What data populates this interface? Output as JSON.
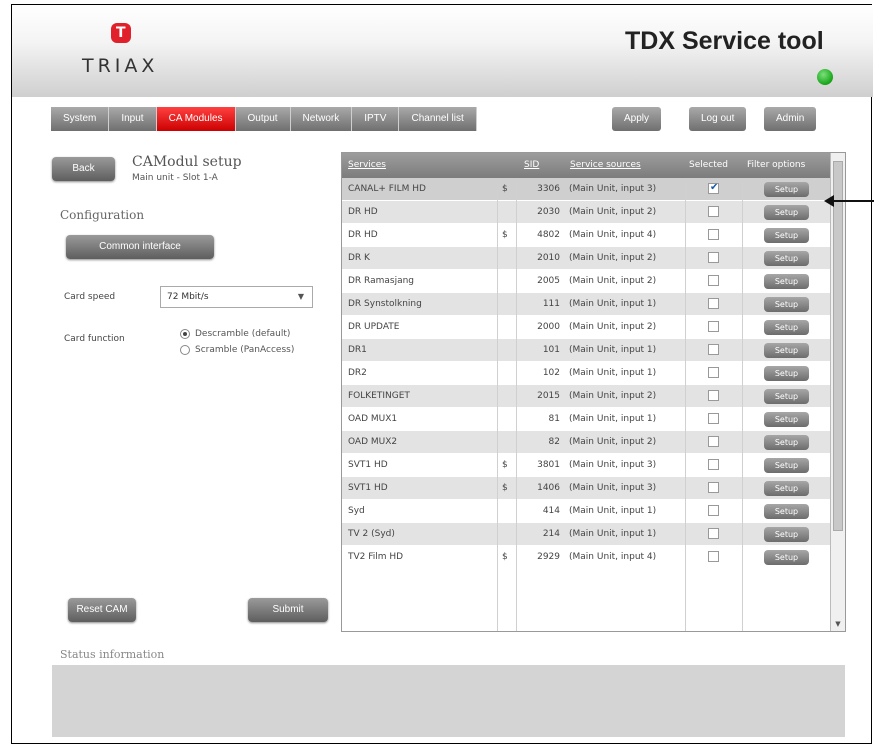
{
  "app": {
    "title": "TDX Service tool",
    "logo_letter": "T",
    "logo_text": "TRIAX"
  },
  "nav": {
    "tabs": [
      {
        "label": "System"
      },
      {
        "label": "Input"
      },
      {
        "label": "CA Modules",
        "active": true
      },
      {
        "label": "Output"
      },
      {
        "label": "Network"
      },
      {
        "label": "IPTV"
      },
      {
        "label": "Channel list"
      }
    ]
  },
  "header_buttons": {
    "apply": "Apply",
    "logout": "Log out",
    "admin": "Admin"
  },
  "page": {
    "back": "Back",
    "title": "CAModul setup",
    "subtitle": "Main unit - Slot 1-A"
  },
  "config": {
    "heading": "Configuration",
    "common_interface": "Common interface",
    "card_speed_label": "Card speed",
    "card_speed_value": "72 Mbit/s",
    "card_function_label": "Card function",
    "radio_descramble": "Descramble (default)",
    "radio_scramble": "Scramble (PanAccess)",
    "radio_selected": "descramble"
  },
  "table": {
    "headers": {
      "services": "Services",
      "sid": "SID",
      "sources": "Service sources",
      "selected": "Selected",
      "filter": "Filter options"
    },
    "setup_label": "Setup",
    "rows": [
      {
        "service": "CANAL+ FILM HD",
        "flag": "$",
        "sid": "3306",
        "source": "(Main Unit, input 3)",
        "selected": true
      },
      {
        "service": "DR HD",
        "flag": "",
        "sid": "2030",
        "source": "(Main Unit, input 2)",
        "selected": false
      },
      {
        "service": "DR HD",
        "flag": "$",
        "sid": "4802",
        "source": "(Main Unit, input 4)",
        "selected": false
      },
      {
        "service": "DR K",
        "flag": "",
        "sid": "2010",
        "source": "(Main Unit, input 2)",
        "selected": false
      },
      {
        "service": "DR Ramasjang",
        "flag": "",
        "sid": "2005",
        "source": "(Main Unit, input 2)",
        "selected": false
      },
      {
        "service": "DR Synstolkning",
        "flag": "",
        "sid": "111",
        "source": "(Main Unit, input 1)",
        "selected": false
      },
      {
        "service": "DR UPDATE",
        "flag": "",
        "sid": "2000",
        "source": "(Main Unit, input 2)",
        "selected": false
      },
      {
        "service": "DR1",
        "flag": "",
        "sid": "101",
        "source": "(Main Unit, input 1)",
        "selected": false
      },
      {
        "service": "DR2",
        "flag": "",
        "sid": "102",
        "source": "(Main Unit, input 1)",
        "selected": false
      },
      {
        "service": "FOLKETINGET",
        "flag": "",
        "sid": "2015",
        "source": "(Main Unit, input 2)",
        "selected": false
      },
      {
        "service": "OAD MUX1",
        "flag": "",
        "sid": "81",
        "source": "(Main Unit, input 1)",
        "selected": false
      },
      {
        "service": "OAD MUX2",
        "flag": "",
        "sid": "82",
        "source": "(Main Unit, input 2)",
        "selected": false
      },
      {
        "service": "SVT1 HD",
        "flag": "$",
        "sid": "3801",
        "source": "(Main Unit, input 3)",
        "selected": false
      },
      {
        "service": "SVT1 HD",
        "flag": "$",
        "sid": "1406",
        "source": "(Main Unit, input 3)",
        "selected": false
      },
      {
        "service": "Syd",
        "flag": "",
        "sid": "414",
        "source": "(Main Unit, input 1)",
        "selected": false
      },
      {
        "service": "TV 2 (Syd)",
        "flag": "",
        "sid": "214",
        "source": "(Main Unit, input 1)",
        "selected": false
      },
      {
        "service": "TV2 Film HD",
        "flag": "$",
        "sid": "2929",
        "source": "(Main Unit, input 4)",
        "selected": false
      }
    ]
  },
  "bottom": {
    "reset_cam": "Reset CAM",
    "submit": "Submit",
    "status_heading": "Status information"
  },
  "colors": {
    "accent": "#cc0000",
    "status_ok": "#16a516",
    "button_gray": "#6f6f6f"
  }
}
